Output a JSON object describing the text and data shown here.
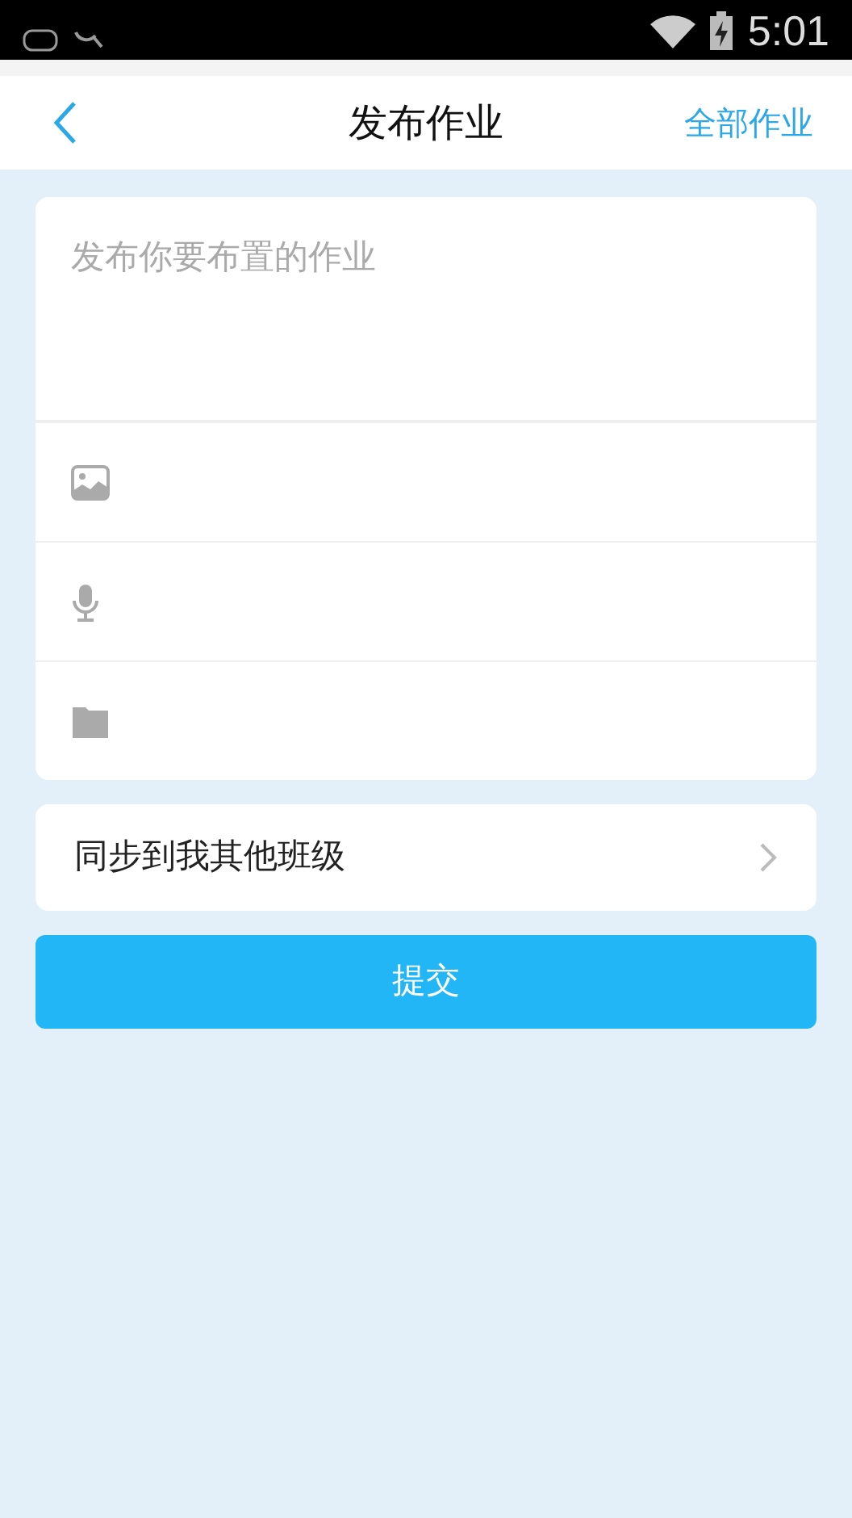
{
  "status_bar": {
    "time": "5:01"
  },
  "header": {
    "title": "发布作业",
    "action": "全部作业"
  },
  "editor": {
    "placeholder": "发布你要布置的作业"
  },
  "attachments": [
    {
      "kind": "image"
    },
    {
      "kind": "voice"
    },
    {
      "kind": "file"
    }
  ],
  "sync": {
    "label": "同步到我其他班级"
  },
  "submit": {
    "label": "提交"
  }
}
